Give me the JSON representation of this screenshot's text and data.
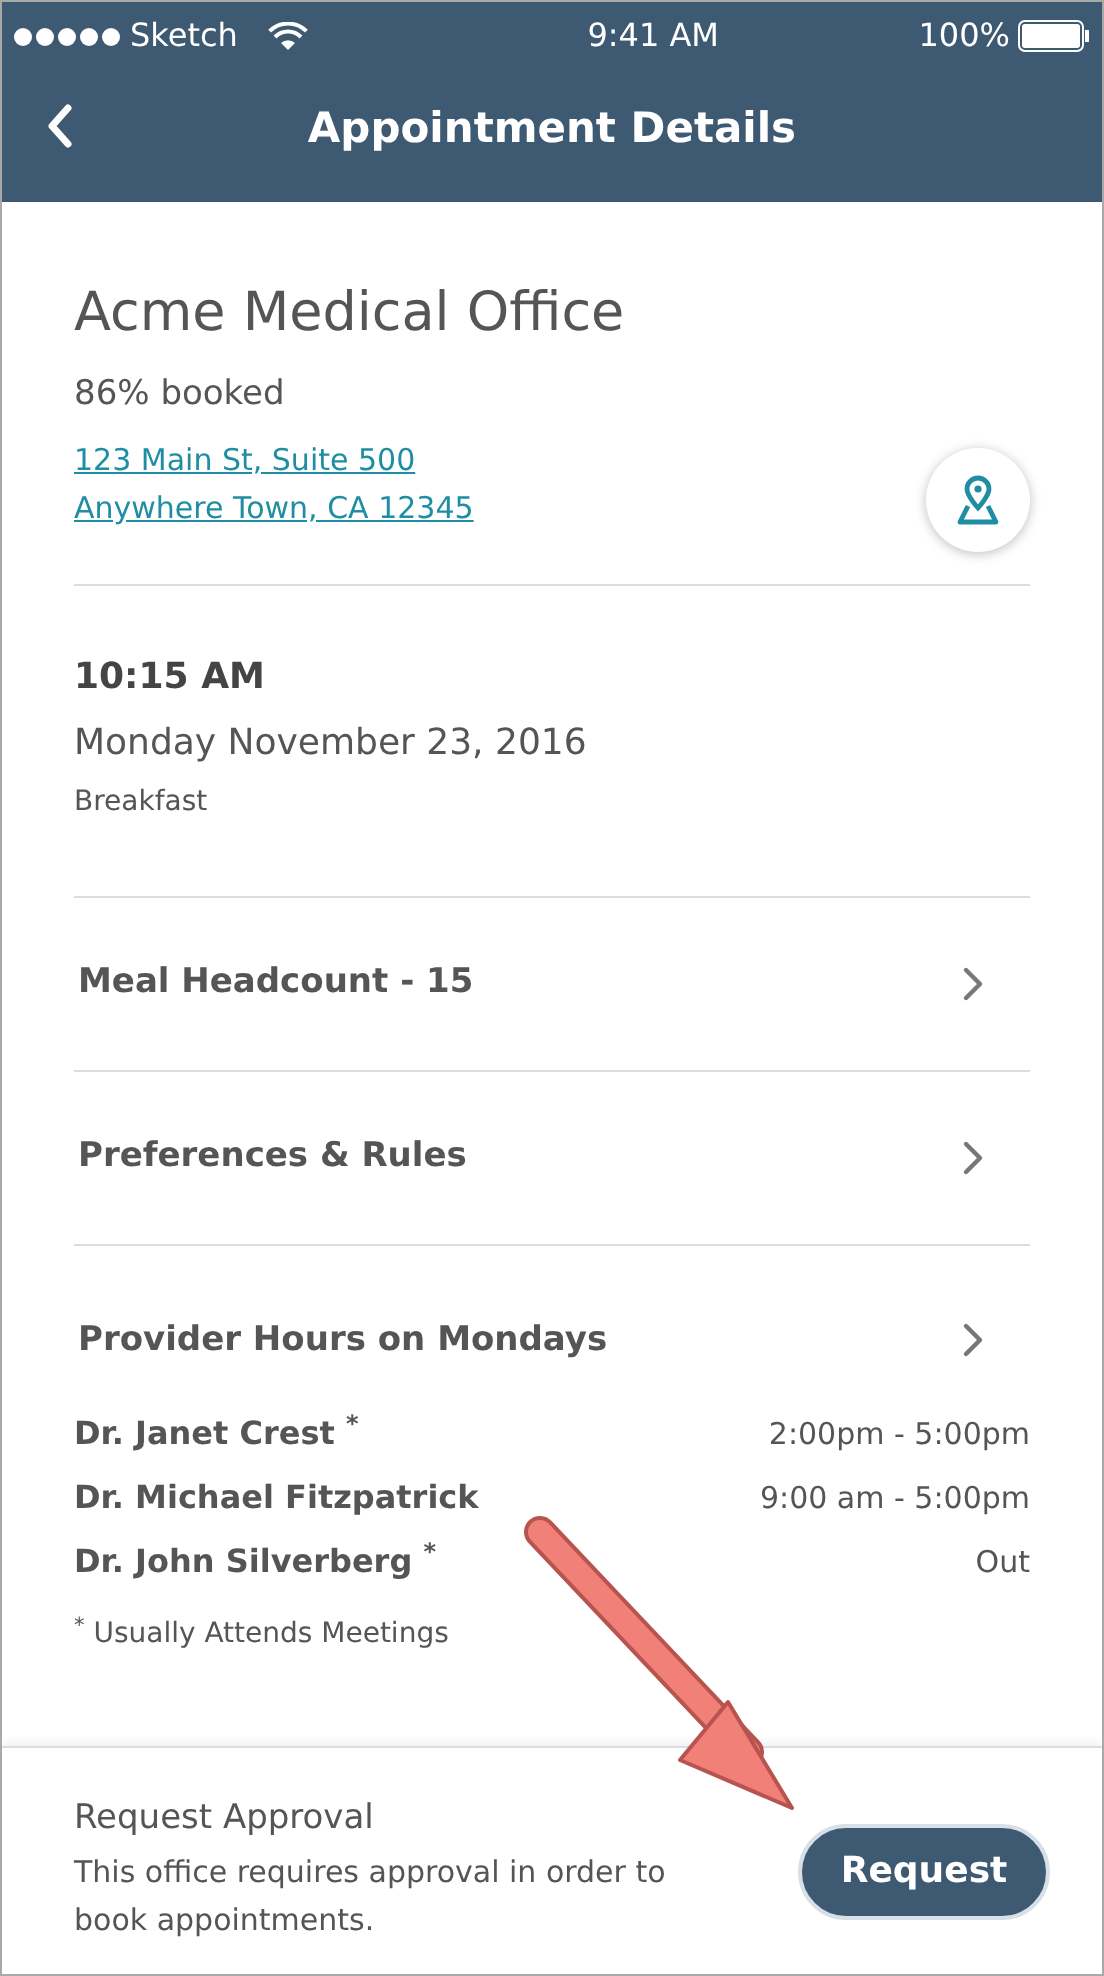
{
  "status_bar": {
    "carrier": "Sketch",
    "time": "9:41 AM",
    "battery": "100%"
  },
  "nav": {
    "title": "Appointment Details"
  },
  "office": {
    "name": "Acme Medical Office",
    "booked": "86% booked",
    "address_lines": [
      "123 Main St, Suite 500",
      "Anywhere Town, CA 12345"
    ]
  },
  "appointment": {
    "time": "10:15 AM",
    "date": "Monday November 23, 2016",
    "meal": "Breakfast"
  },
  "rows": [
    {
      "label": "Meal Headcount - 15"
    },
    {
      "label": "Preferences & Rules"
    },
    {
      "label": "Provider Hours on Mondays"
    }
  ],
  "providers": [
    {
      "name": "Dr. Janet Crest $^{*}$",
      "hours": "2:00pm - 5:00pm"
    },
    {
      "name": "Dr. Michael Fitzpatrick",
      "hours": "9:00 am - 5:00pm"
    },
    {
      "name": "Dr. John Silverberg $^{*}$",
      "hours": "Out"
    }
  ],
  "footnote": "$^{*}$ Usually Attends Meetings",
  "footer": {
    "title": "Request Approval",
    "text": "This office requires approval in order to book appointments.",
    "button": "Request"
  }
}
